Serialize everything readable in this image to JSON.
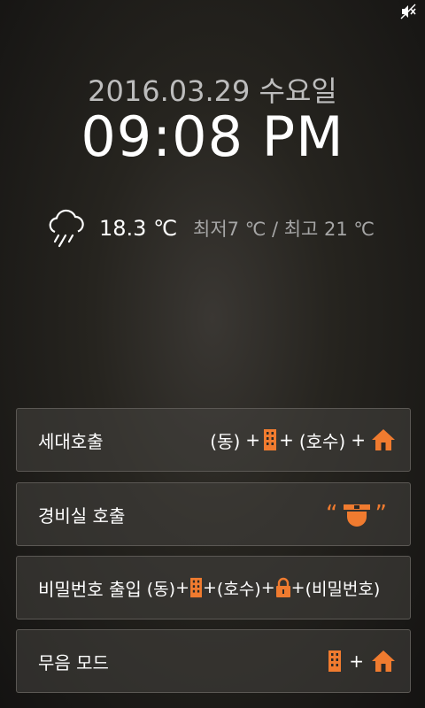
{
  "status_bar": {
    "icon": "mute-speaker-icon"
  },
  "clock": {
    "date": "2016.03.29 수요일",
    "time": "09:08 PM"
  },
  "weather": {
    "icon": "cloud-rain-icon",
    "temperature": "18.3 ℃",
    "range": "최저7 ℃ / 최고 21 ℃"
  },
  "menu": {
    "household_call": {
      "label": "세대호출",
      "dong": "(동)",
      "ho": "(호수)",
      "plus": "+"
    },
    "guard_call": {
      "label": "경비실 호출",
      "quote_open": "“",
      "quote_close": "”"
    },
    "password_entry": {
      "label": "비밀번호 출입",
      "dong": "(동)",
      "ho": "(호수)",
      "password": "(비밀번호)",
      "plus": "+"
    },
    "silent_mode": {
      "label": "무음 모드",
      "plus": "+"
    }
  },
  "colors": {
    "accent": "#f07b2f"
  }
}
